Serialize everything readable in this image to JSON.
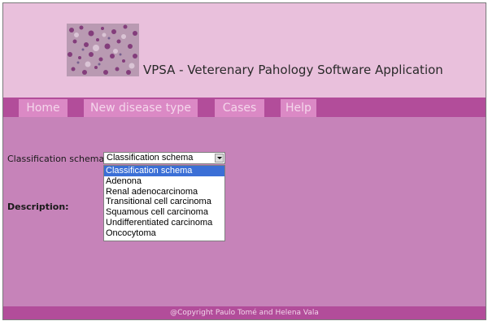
{
  "header": {
    "logo_alt": "histology micrograph",
    "title": "VPSA - Veterenary Pahology Software Application"
  },
  "nav": {
    "items": [
      {
        "label": "Home"
      },
      {
        "label": "New disease type"
      },
      {
        "label": "Cases"
      },
      {
        "label": "Help"
      }
    ]
  },
  "form": {
    "classification_label": "Classification schema:",
    "classification_value": "Classification schema",
    "description_label": "Description:",
    "options": [
      "Classification schema",
      "Adenona",
      "Renal adenocarcinoma",
      "Transitional cell carcinoma",
      "Squamous cell carcinoma",
      "Undifferentiated carcinoma",
      "Oncocytoma"
    ]
  },
  "footer": {
    "text": "@Copyright Paulo Tomé and Helena Vala"
  },
  "colors": {
    "header_bg": "#e9c0dc",
    "nav_bar": "#b24d9a",
    "nav_item_bg": "#db89c5",
    "content_bg": "#c683b9",
    "selected_option": "#3b6fd6"
  }
}
